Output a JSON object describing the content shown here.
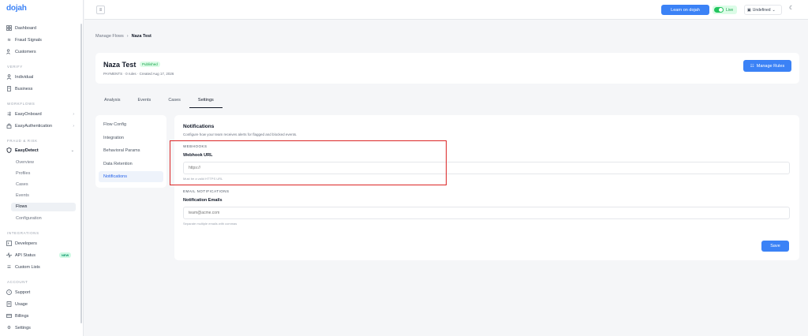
{
  "sidebar": {
    "brand": "dojah",
    "top_items": [
      {
        "label": "Dashboard",
        "icon": "grid-icon"
      },
      {
        "label": "Fraud Signals",
        "icon": "signal-icon"
      },
      {
        "label": "Customers",
        "icon": "users-icon"
      }
    ],
    "verify_label": "VERIFY",
    "verify_items": [
      {
        "label": "Individual",
        "icon": "user-icon"
      },
      {
        "label": "Business",
        "icon": "building-icon"
      }
    ],
    "workflows_label": "WORKFLOWS",
    "workflow_items": [
      {
        "label": "EasyOnboard",
        "icon": "flow-icon"
      },
      {
        "label": "EasyAuthentication",
        "icon": "lock-icon"
      }
    ],
    "fraud_label": "FRAUD & RISK",
    "easydetect": {
      "label": "EasyDetect",
      "icon": "shield-icon"
    },
    "easydetect_sub": [
      "Overview",
      "Profiles",
      "Cases",
      "Events",
      "Flows",
      "Configuration"
    ],
    "active_sub": "Flows",
    "integrations_label": "INTEGRATIONS",
    "integration_items": [
      {
        "label": "Developers",
        "icon": "code-icon"
      },
      {
        "label": "API Status",
        "icon": "pulse-icon"
      },
      {
        "label": "Custom Lists",
        "icon": "list-icon"
      }
    ],
    "new_badge": "NEW",
    "account_label": "ACCOUNT",
    "account_items": [
      {
        "label": "Support",
        "icon": "help-icon"
      },
      {
        "label": "Usage",
        "icon": "file-icon"
      },
      {
        "label": "Billings",
        "icon": "card-icon"
      },
      {
        "label": "Settings",
        "icon": "gear-icon"
      }
    ]
  },
  "topbar": {
    "learn_button": "Learn on dojah",
    "live_label": "Live",
    "env_label": "Undefined",
    "theme_icon": "moon-icon"
  },
  "breadcrumb": {
    "parent": "Manage Flows",
    "separator": "›",
    "current": "Naza Test"
  },
  "flow": {
    "title": "Naza Test",
    "status": "Published",
    "meta": "PAYMENTS · 0 rules · Created Aug 17, 2026",
    "manage_rules": "Manage Rules"
  },
  "tabs": [
    "Analysis",
    "Events",
    "Cases",
    "Settings"
  ],
  "active_tab": "Settings",
  "settings_nav": [
    "Flow Config",
    "Integration",
    "Behavioral Params",
    "Data Retention",
    "Notifications"
  ],
  "active_settings": "Notifications",
  "notifications": {
    "title": "Notifications",
    "description": "Configure how your team receives alerts for flagged and blocked events.",
    "webhooks_label": "WEBHOOKS",
    "webhook_url_label": "Webhook URL",
    "webhook_placeholder": "https://",
    "webhook_help": "Must be a valid HTTPS URL",
    "email_label": "EMAIL NOTIFICATIONS",
    "emails_label": "Notification Emails",
    "emails_placeholder": "team@acme.com",
    "emails_help": "Separate multiple emails with commas",
    "save": "Save"
  },
  "colors": {
    "accent": "#3b82f6",
    "highlight": "#dc2626",
    "live": "#22c55e"
  }
}
